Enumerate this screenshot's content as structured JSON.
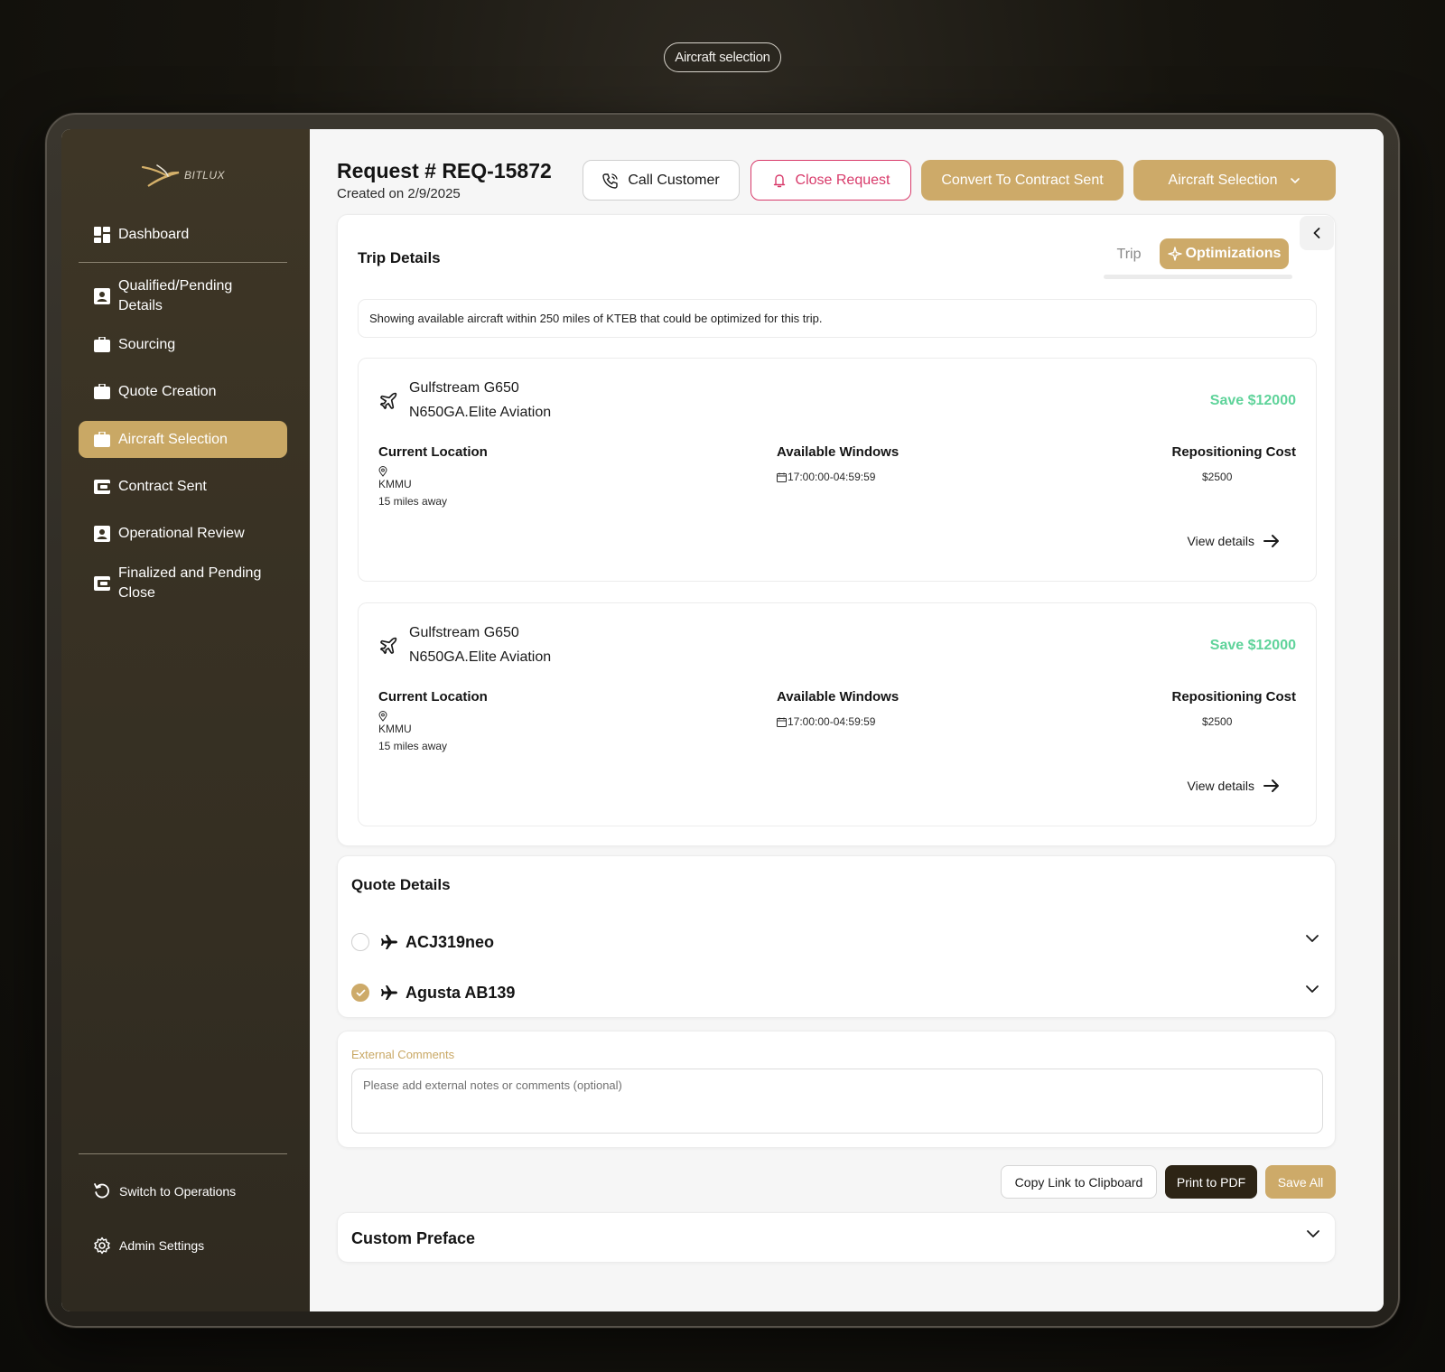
{
  "top_label": "Aircraft selection",
  "brand": {
    "name": "BITLUX",
    "accent": "#cdaa69"
  },
  "sidebar": {
    "items": [
      {
        "label": "Dashboard",
        "icon": "dashboard-icon"
      },
      {
        "label": "Qualified/Pending Details",
        "icon": "profile-card-icon"
      },
      {
        "label": "Sourcing",
        "icon": "briefcase-icon"
      },
      {
        "label": "Quote Creation",
        "icon": "briefcase-icon"
      },
      {
        "label": "Aircraft Selection",
        "icon": "briefcase-icon",
        "active": true
      },
      {
        "label": "Contract Sent",
        "icon": "wallet-icon"
      },
      {
        "label": "Operational Review",
        "icon": "profile-card-icon"
      },
      {
        "label": "Finalized and Pending Close",
        "icon": "wallet-icon"
      }
    ],
    "switch_label": "Switch to Operations",
    "admin_label": "Admin Settings"
  },
  "header": {
    "title": "Request # REQ-15872",
    "created": "Created on 2/9/2025",
    "call_label": "Call Customer",
    "close_label": "Close Request",
    "convert_label": "Convert To Contract Sent",
    "aircraft_label": "Aircraft Selection"
  },
  "trip": {
    "title": "Trip Details",
    "tab_trip": "Trip",
    "tab_optimizations": "Optimizations",
    "info": "Showing available aircraft within 250 miles of KTEB that could be optimized for this trip.",
    "aircraft": [
      {
        "name": "Gulfstream G650",
        "operator": "N650GA.Elite Aviation",
        "save": "Save $12000",
        "location_label": "Current Location",
        "location_code": "KMMU",
        "distance": "15 miles away",
        "windows_label": "Available Windows",
        "window": "17:00:00-04:59:59",
        "cost_label": "Repositioning Cost",
        "cost": "$2500",
        "view_label": "View details"
      },
      {
        "name": "Gulfstream G650",
        "operator": "N650GA.Elite Aviation",
        "save": "Save $12000",
        "location_label": "Current Location",
        "location_code": "KMMU",
        "distance": "15 miles away",
        "windows_label": "Available Windows",
        "window": "17:00:00-04:59:59",
        "cost_label": "Repositioning Cost",
        "cost": "$2500",
        "view_label": "View details"
      }
    ]
  },
  "quote": {
    "title": "Quote Details",
    "items": [
      {
        "name": "ACJ319neo",
        "checked": false
      },
      {
        "name": "Agusta AB139",
        "checked": true
      }
    ]
  },
  "comments": {
    "label": "External Comments",
    "placeholder": "Please add external notes or comments (optional)"
  },
  "actions": {
    "copy_label": "Copy Link to Clipboard",
    "pdf_label": "Print to PDF",
    "save_label": "Save All"
  },
  "preface": {
    "title": "Custom Preface"
  }
}
